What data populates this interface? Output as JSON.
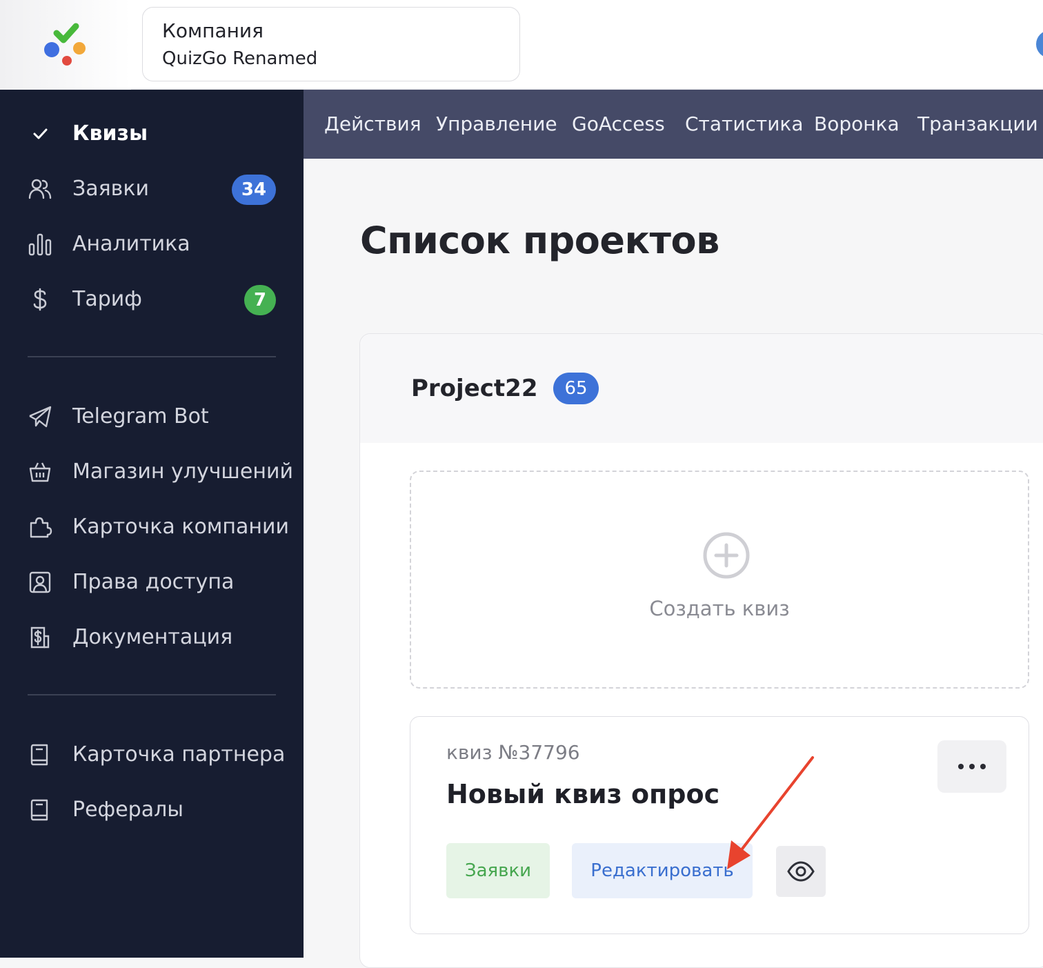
{
  "header": {
    "company_label": "Компания",
    "company_name": "QuizGo Renamed"
  },
  "sidebar": {
    "items": [
      {
        "label": "Квизы",
        "icon": "check-icon",
        "active": true
      },
      {
        "label": "Заявки",
        "icon": "users-icon",
        "badge": "34",
        "badge_color": "#3d72d8"
      },
      {
        "label": "Аналитика",
        "icon": "bar-chart-icon"
      },
      {
        "label": "Тариф",
        "icon": "dollar-icon",
        "badge": "7",
        "badge_color": "#45b152"
      },
      {
        "label": "Telegram Bot",
        "icon": "telegram-icon"
      },
      {
        "label": "Магазин улучшений",
        "icon": "basket-icon"
      },
      {
        "label": "Карточка компании",
        "icon": "puzzle-icon"
      },
      {
        "label": "Права доступа",
        "icon": "user-badge-icon"
      },
      {
        "label": "Документация",
        "icon": "document-dollar-icon"
      },
      {
        "label": "Карточка партнера",
        "icon": "book-icon"
      },
      {
        "label": "Рефералы",
        "icon": "book-icon"
      }
    ]
  },
  "tabs": [
    "Действия",
    "Управление",
    "GoAccess",
    "Статистика",
    "Воронка",
    "Транзакции"
  ],
  "main": {
    "title": "Список проектов",
    "project": {
      "name": "Project22",
      "count": "65"
    },
    "create": {
      "label": "Создать квиз"
    },
    "quiz": {
      "number": "квиз №37796",
      "title": "Новый квиз опрос",
      "leads_button": "Заявки",
      "edit_button": "Редактировать"
    }
  },
  "colors": {
    "sidebar_bg": "#171d31",
    "tabs_bg": "#454a67",
    "accent_blue": "#3d72d8",
    "accent_green": "#45b152",
    "annotation_arrow": "#e8432e"
  }
}
